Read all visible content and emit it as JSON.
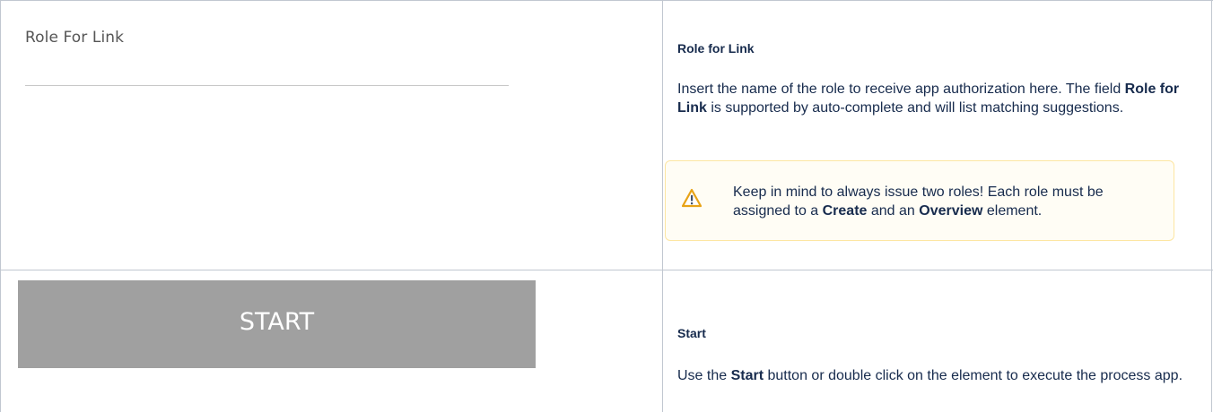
{
  "role_section": {
    "field_label": "Role For Link",
    "doc_title": "Role for Link",
    "doc_text_1": "Insert the name of the role to receive app authorization here. The field ",
    "doc_text_bold": "Role for Link",
    "doc_text_2": " is supported by auto-complete and will list matching suggestions.",
    "warning": {
      "icon": "warning-triangle-icon",
      "text_1": "Keep in mind to always issue two roles! Each role must be assigned to a ",
      "bold_1": "Create",
      "text_2": " and an ",
      "bold_2": "Overview",
      "text_3": " element.",
      "accent_color": "#f5a623"
    }
  },
  "start_section": {
    "button_label": "START",
    "button_color": "#a0a0a0",
    "doc_title": "Start",
    "doc_text_1": "Use the ",
    "doc_text_bold": "Start",
    "doc_text_2": " button or double click on the element to execute the process app."
  }
}
